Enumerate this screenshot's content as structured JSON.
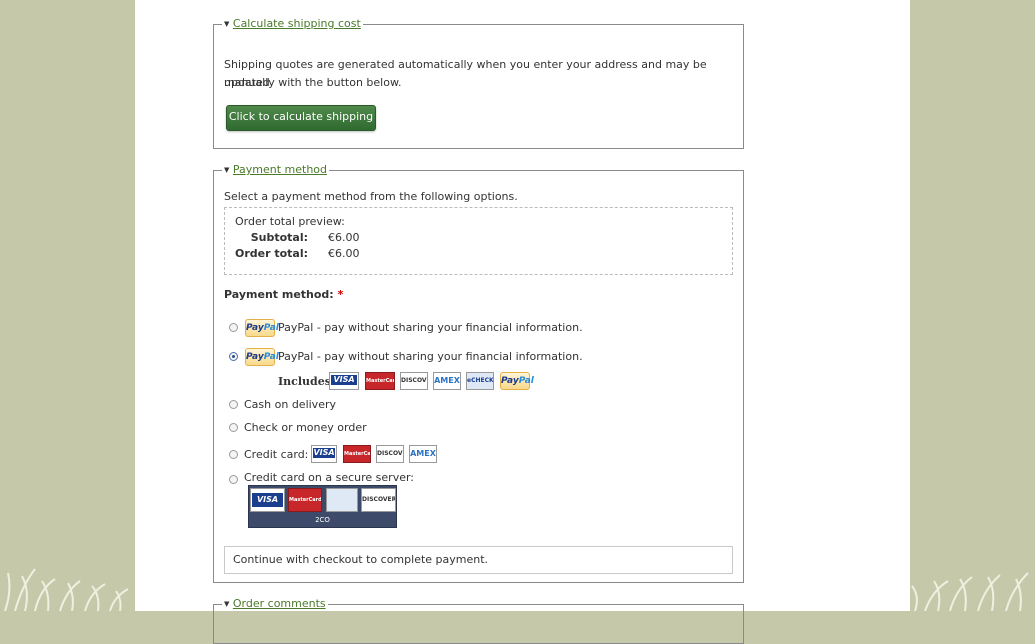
{
  "shipping": {
    "legend": "Calculate shipping cost",
    "description_line1": "Shipping quotes are generated automatically when you enter your address and may be updated",
    "description_line2": "manually with the button below.",
    "button_label": "Click to calculate shipping"
  },
  "payment": {
    "legend": "Payment method",
    "intro": "Select a payment method from the following options.",
    "preview": {
      "title": "Order total preview:",
      "subtotal_label": "Subtotal:",
      "subtotal_value": "€6.00",
      "total_label": "Order total:",
      "total_value": "€6.00"
    },
    "method_label": "Payment method:",
    "required_mark": "*",
    "options": [
      {
        "label": "PayPal - pay without sharing your financial information.",
        "selected": false,
        "icon": "paypal-icon"
      },
      {
        "label": "PayPal - pay without sharing your financial information.",
        "selected": true,
        "icon": "paypal-icon"
      },
      {
        "label": "Cash on delivery",
        "selected": false
      },
      {
        "label": "Check or money order",
        "selected": false
      },
      {
        "label": "Credit card:",
        "selected": false
      },
      {
        "label": "Credit card on a secure server:",
        "selected": false
      }
    ],
    "includes_label": "Includes:",
    "card_text": {
      "visa": "VISA",
      "mastercard": "MasterCard",
      "discover": "DISCOVER",
      "amex": "AMEX",
      "echeck": "eCHECK",
      "paypal_a": "Pay",
      "paypal_b": "Pal",
      "twoco": "2CO"
    },
    "continue_text": "Continue with checkout to complete payment."
  },
  "comments": {
    "legend": "Order comments"
  },
  "colors": {
    "background": "#c5c9a9",
    "button": "#3d7a3a",
    "link": "#4a7a2a",
    "required": "#cc0000"
  }
}
